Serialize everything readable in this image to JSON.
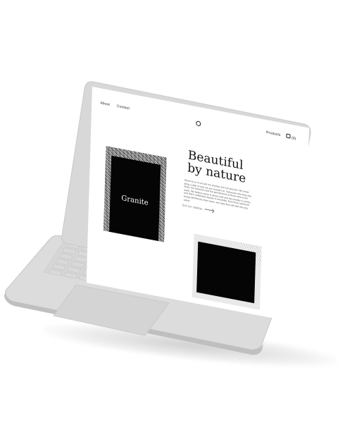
{
  "screen": {
    "nav": {
      "about": "About",
      "contact": "Contact",
      "products": "Products",
      "cart_count": "(0)"
    },
    "hero": {
      "title_line1": "Beautiful",
      "title_line2": "by nature",
      "paragraph": "Stone to us is not just our product, but our passion. We never bring a slab of rock we are unaware of. Someone who loves the finish, the precision and the permanence of those who is the earth. We believe stone is about craft and the wonder it carries, and that it celebrates beauty in everyday. Each time someone brings MOTM into their home, we hope they will feel the very same.",
      "link": "See our catalog"
    },
    "cards": {
      "granite_label": "Granite"
    }
  },
  "colors": {
    "device": "#d9d9d9",
    "device_edge": "#c4c4c4",
    "screen_bg": "#ffffff",
    "card_black": "#050505"
  },
  "icons": {
    "logo": "logo-mark-icon",
    "cart": "cart-icon",
    "arrow": "arrow-right-icon"
  }
}
